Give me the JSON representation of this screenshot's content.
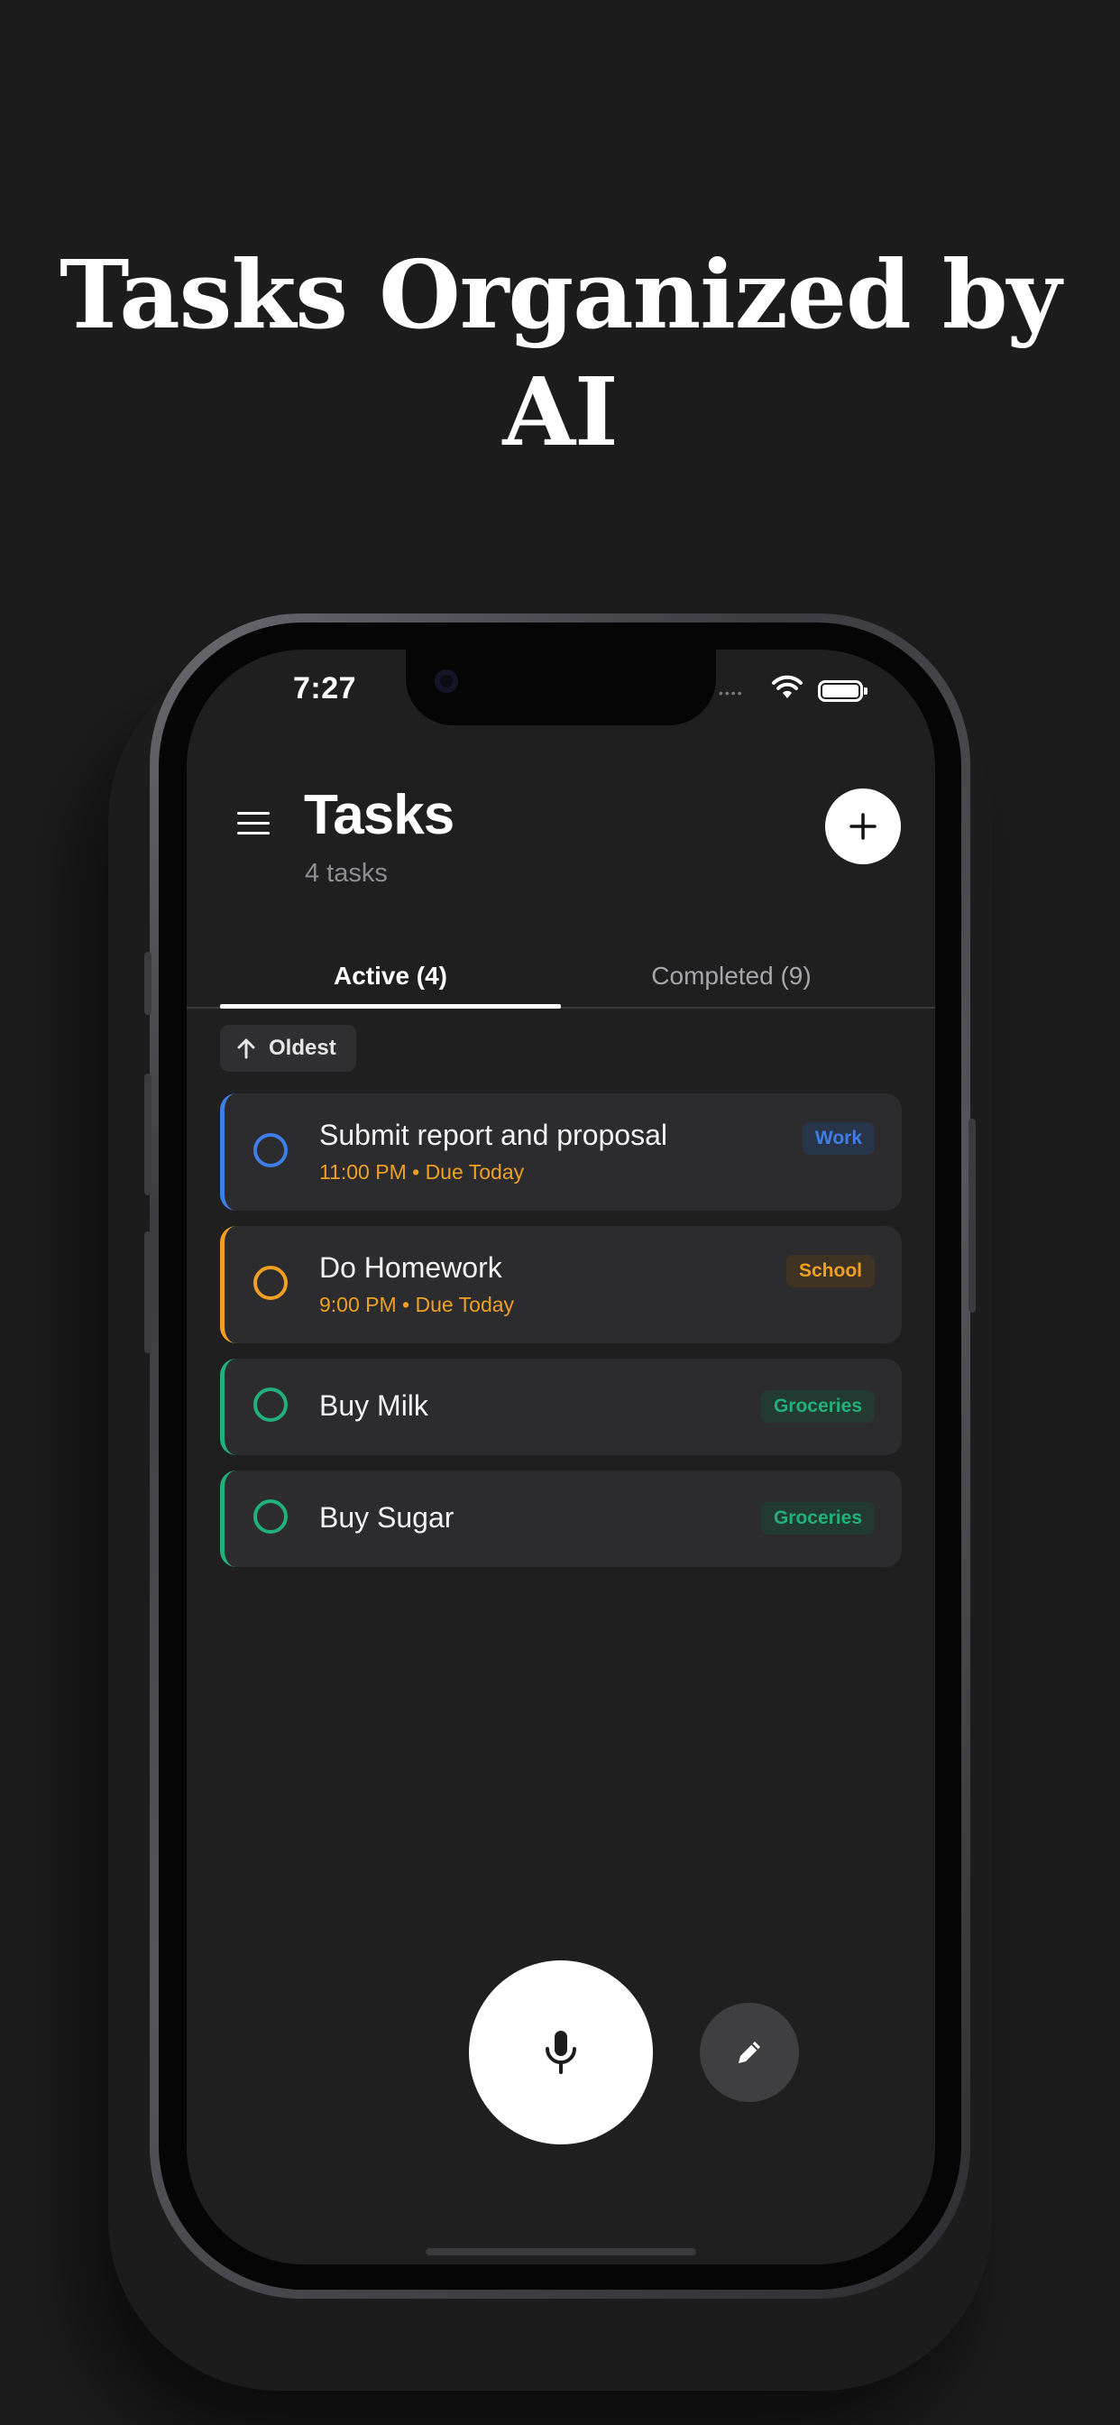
{
  "hero": {
    "title": "Tasks Organized by AI"
  },
  "status_bar": {
    "time": "7:27",
    "dots": "••••"
  },
  "header": {
    "title": "Tasks",
    "subtitle": "4 tasks"
  },
  "tabs": [
    {
      "label": "Active (4)",
      "active": true
    },
    {
      "label": "Completed (9)",
      "active": false
    }
  ],
  "sort": {
    "label": "Oldest",
    "icon": "arrow-up-icon"
  },
  "tasks": [
    {
      "title": "Submit report and proposal",
      "due": "11:00 PM • Due Today",
      "tag": "Work",
      "color": "#3d7fe6"
    },
    {
      "title": "Do Homework",
      "due": "9:00 PM • Due Today",
      "tag": "School",
      "color": "#f0a020"
    },
    {
      "title": "Buy Milk",
      "due": "",
      "tag": "Groceries",
      "color": "#21b07a"
    },
    {
      "title": "Buy Sugar",
      "due": "",
      "tag": "Groceries",
      "color": "#21b07a"
    }
  ],
  "colors": {
    "background": "#1c1c1d",
    "screen": "#1f1f20",
    "card": "#2c2c2e",
    "work": "#3d7fe6",
    "school": "#f0a020",
    "groceries": "#21b07a"
  },
  "icons": {
    "menu": "hamburger-menu-icon",
    "add": "plus-icon",
    "mic": "microphone-icon",
    "edit": "pencil-icon"
  }
}
